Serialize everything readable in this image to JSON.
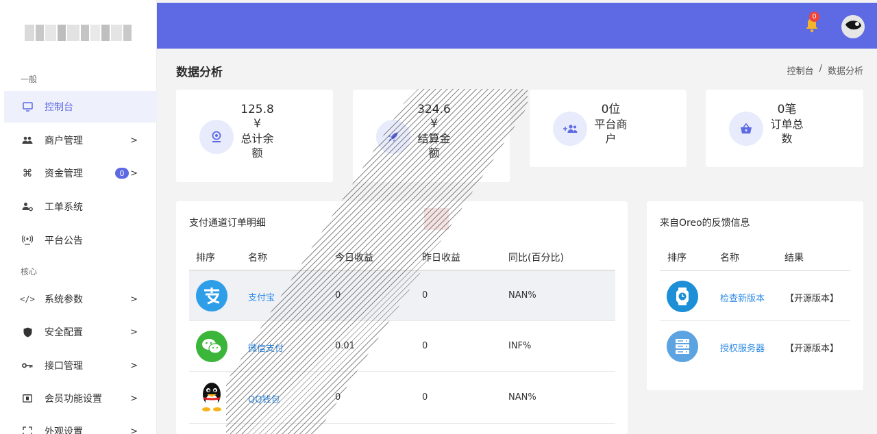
{
  "sidebar": {
    "section_general": "一般",
    "section_core": "核心",
    "items": [
      {
        "label": "控制台",
        "icon": "monitor-icon",
        "active": true
      },
      {
        "label": "商户管理",
        "icon": "users-icon",
        "chevron": ">"
      },
      {
        "label": "资金管理",
        "icon": "command-icon",
        "badge": "0",
        "chevron": ">"
      },
      {
        "label": "工单系统",
        "icon": "user-gear-icon"
      },
      {
        "label": "平台公告",
        "icon": "broadcast-icon"
      },
      {
        "label": "系统参数",
        "icon": "code-icon",
        "chevron": ">"
      },
      {
        "label": "安全配置",
        "icon": "shield-icon",
        "chevron": ">"
      },
      {
        "label": "接口管理",
        "icon": "key-icon",
        "chevron": ">"
      },
      {
        "label": "会员功能设置",
        "icon": "card-icon",
        "chevron": ">"
      },
      {
        "label": "外观设置",
        "icon": "layout-icon",
        "chevron": ">"
      }
    ]
  },
  "topbar": {
    "notification_count": "0",
    "accent": "#5d6ae3"
  },
  "page": {
    "title": "数据分析",
    "breadcrumb": [
      "控制台",
      "/",
      "数据分析"
    ]
  },
  "stats": [
    {
      "value": "125.8",
      "unit": "¥",
      "label1": "总计余",
      "label2": "额",
      "icon": "wallet-icon"
    },
    {
      "value": "324.6",
      "unit": "¥",
      "label1": "结算金",
      "label2": "额",
      "icon": "rocket-icon"
    },
    {
      "value": "0位",
      "label1": "平台商",
      "label2": "户",
      "icon": "user-plus-icon"
    },
    {
      "value": "0笔",
      "label1": "订单总",
      "label2": "数",
      "icon": "basket-icon"
    }
  ],
  "channels": {
    "title": "支付通道订单明细",
    "headers": [
      "排序",
      "名称",
      "今日收益",
      "昨日收益",
      "同比(百分比)"
    ],
    "rows": [
      {
        "name": "支付宝",
        "today": "0",
        "yesterday": "0",
        "ratio": "NAN%",
        "icon": "alipay-icon"
      },
      {
        "name": "微信支付",
        "today": "0.01",
        "yesterday": "0",
        "ratio": "INF%",
        "icon": "wechat-icon"
      },
      {
        "name": "QQ钱包",
        "today": "0",
        "yesterday": "0",
        "ratio": "NAN%",
        "icon": "qq-penguin-icon"
      }
    ]
  },
  "feedback": {
    "title": "来自Oreo的反馈信息",
    "headers": [
      "排序",
      "名称",
      "结果"
    ],
    "rows": [
      {
        "name": "检查新版本",
        "result": "【开源版本】",
        "icon": "watch-icon"
      },
      {
        "name": "授权服务器",
        "result": "【开源版本】",
        "icon": "server-icon"
      }
    ]
  }
}
